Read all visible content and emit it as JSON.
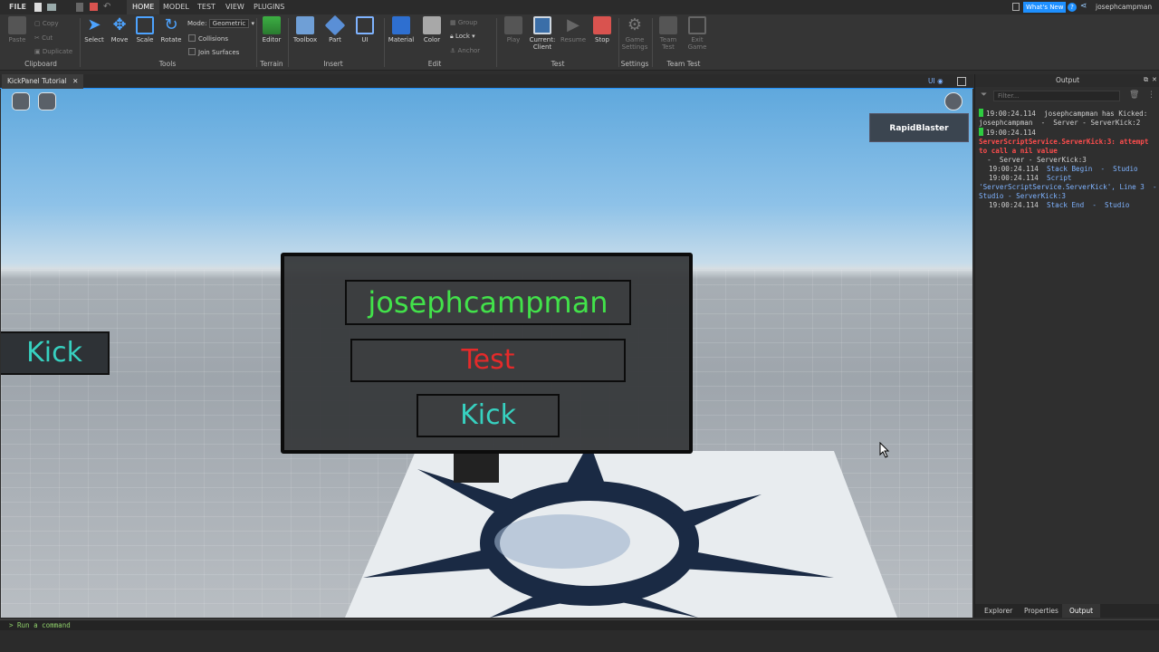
{
  "menubar": {
    "file": "FILE",
    "tabs": [
      "HOME",
      "MODEL",
      "TEST",
      "VIEW",
      "PLUGINS"
    ],
    "active_tab": "HOME",
    "whats_new": "What's New",
    "username": "josephcampman"
  },
  "ribbon": {
    "clipboard": {
      "paste": "Paste",
      "copy": "Copy",
      "cut": "Cut",
      "duplicate": "Duplicate",
      "label": "Clipboard"
    },
    "tools": {
      "select": "Select",
      "move": "Move",
      "scale": "Scale",
      "rotate": "Rotate",
      "mode_label": "Mode:",
      "mode_value": "Geometric",
      "collisions": "Collisions",
      "join_surfaces": "Join Surfaces",
      "label": "Tools"
    },
    "terrain": {
      "editor": "Editor",
      "label": "Terrain"
    },
    "insert": {
      "toolbox": "Toolbox",
      "part": "Part",
      "ui": "UI",
      "label": "Insert"
    },
    "edit": {
      "material": "Material",
      "color": "Color",
      "group": "Group",
      "lock": "Lock",
      "anchor": "Anchor",
      "label": "Edit"
    },
    "test": {
      "play": "Play",
      "current_client_1": "Current:",
      "current_client_2": "Client",
      "resume": "Resume",
      "stop": "Stop",
      "label": "Test"
    },
    "settings": {
      "game_settings_1": "Game",
      "game_settings_2": "Settings",
      "label": "Settings"
    },
    "team_test": {
      "team_test_1": "Team",
      "team_test_2": "Test",
      "exit_game_1": "Exit",
      "exit_game_2": "Game",
      "label": "Team Test"
    }
  },
  "document": {
    "tab_title": "KickPanel Tutorial",
    "ui_toggle": "UI"
  },
  "viewport": {
    "leaderboard_player": "RapidBlaster",
    "side_button": "Kick",
    "panel": {
      "player_name": "josephcampman",
      "reason": "Test",
      "kick_button": "Kick"
    }
  },
  "output": {
    "title": "Output",
    "filter_placeholder": "Filter...",
    "lines": [
      {
        "time": "19:00:24.114",
        "text": "josephcampman has Kicked: josephcampman  -  Server - ServerKick:2",
        "kind": "normal",
        "marker": true
      },
      {
        "time": "19:00:24.114",
        "text": "",
        "kind": "normal",
        "marker": true
      },
      {
        "time": "",
        "text": "ServerScriptService.ServerKick:3: attempt to call a nil value",
        "kind": "error",
        "marker": false
      },
      {
        "time": "",
        "text": "  -  Server - ServerKick:3",
        "kind": "normal",
        "marker": false
      },
      {
        "time": "19:00:24.114",
        "text": "Stack Begin  -  Studio",
        "kind": "blue",
        "marker": false
      },
      {
        "time": "19:00:24.114",
        "text": "Script 'ServerScriptService.ServerKick', Line 3  -  Studio - ServerKick:3",
        "kind": "blue",
        "marker": false
      },
      {
        "time": "19:00:24.114",
        "text": "Stack End  -  Studio",
        "kind": "blue",
        "marker": false
      }
    ],
    "bottom_tabs": [
      "Explorer",
      "Properties",
      "Output"
    ],
    "active_bottom_tab": "Output"
  },
  "command_bar": {
    "placeholder": "Run a command"
  },
  "colors": {
    "accent": "#1e90ff",
    "name_green": "#42e24a",
    "reason_red": "#e52a2a",
    "kick_cyan": "#37d1c0",
    "error_red": "#ff4d4d"
  }
}
